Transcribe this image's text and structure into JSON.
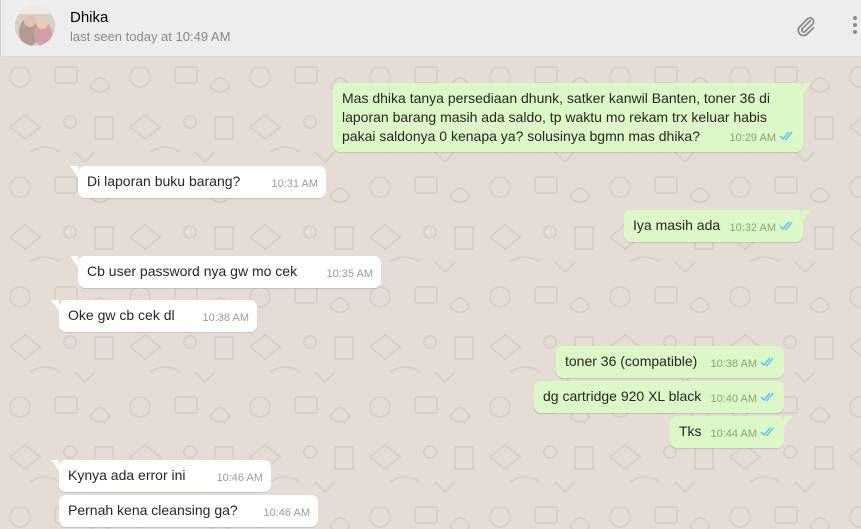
{
  "contact": {
    "name": "Dhika",
    "status": "last seen today at 10:49 AM"
  },
  "icons": {
    "attach": "paperclip-icon",
    "menu": "vertical-dots-icon",
    "read_receipt": "double-check-icon"
  },
  "colors": {
    "incoming_bubble": "#ffffff",
    "outgoing_bubble": "#dcf8c6",
    "chat_background": "#e5ddd5",
    "read_tick": "#4fc3f7"
  },
  "messages": [
    {
      "direction": "out",
      "lines": [
        "Mas dhika tanya persediaan dhunk, satker kanwil Banten, toner 36 di",
        "laporan barang masih ada saldo, tp waktu mo rekam trx keluar habis",
        "pakai saldonya 0 kenapa ya? solusinya bgmn mas dhika?"
      ],
      "time": "10:29 AM"
    },
    {
      "direction": "in",
      "lines": [
        "Di laporan buku barang?"
      ],
      "time": "10:31 AM"
    },
    {
      "direction": "out",
      "lines": [
        "Iya masih ada"
      ],
      "time": "10:32 AM"
    },
    {
      "direction": "in",
      "lines": [
        "Cb user password nya gw mo cek"
      ],
      "time": "10:35 AM"
    },
    {
      "direction": "in",
      "lines": [
        "Oke gw cb cek dl"
      ],
      "time": "10:38 AM"
    },
    {
      "direction": "out",
      "lines": [
        "toner 36 (compatible)"
      ],
      "time": "10:38 AM"
    },
    {
      "direction": "out",
      "lines": [
        "dg cartridge 920 XL black"
      ],
      "time": "10:40 AM"
    },
    {
      "direction": "out",
      "lines": [
        "Tks"
      ],
      "time": "10:44 AM"
    },
    {
      "direction": "in",
      "lines": [
        "Kynya ada error ini"
      ],
      "time": "10:46 AM"
    },
    {
      "direction": "in",
      "lines": [
        "Pernah kena cleansing ga?"
      ],
      "time": "10:46 AM"
    }
  ]
}
